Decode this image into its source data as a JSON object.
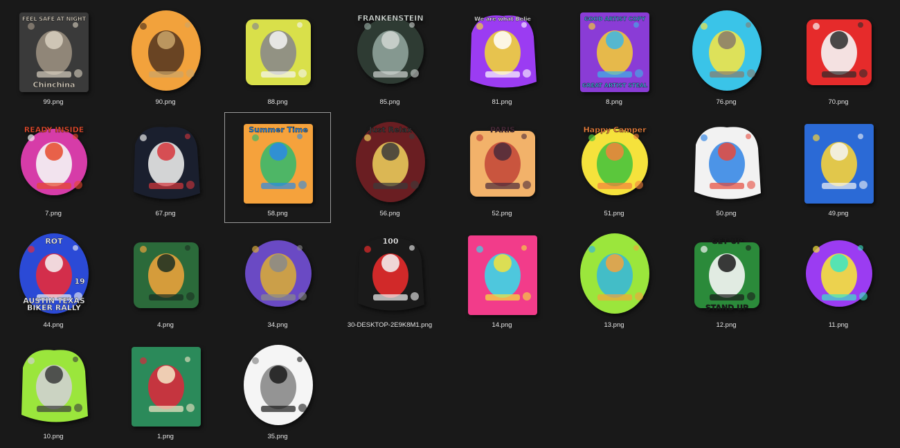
{
  "window": {
    "view": "Large icons"
  },
  "files": [
    {
      "name": "99.png",
      "icon": "night-animal-sticker-thumbnail",
      "palette": [
        "#3a3a3a",
        "#9a8f80",
        "#d9d0c0"
      ],
      "art_text": "FEEL SAFE AT NIGHT",
      "art_text2": "Chinchina"
    },
    {
      "name": "90.png",
      "icon": "hunter-with-dog-thumbnail",
      "palette": [
        "#f2a23c",
        "#5a3a20",
        "#caa56a"
      ]
    },
    {
      "name": "88.png",
      "icon": "money-gangster-badge-thumbnail",
      "palette": [
        "#d9e04a",
        "#8a8a8a",
        "#f5f5f5"
      ]
    },
    {
      "name": "85.png",
      "icon": "frankenstein-portrait-thumbnail",
      "palette": [
        "#2e3b33",
        "#8fa39a",
        "#d0d6d2"
      ],
      "art_text": "FRANKENSTEIN"
    },
    {
      "name": "81.png",
      "icon": "graffiti-lettering-thumbnail",
      "palette": [
        "#9b3cf2",
        "#f0d23c",
        "#ffffff"
      ],
      "art_text": "We are what Belie"
    },
    {
      "name": "8.png",
      "icon": "pop-art-artist-thumbnail",
      "palette": [
        "#8a3cd6",
        "#f0c63c",
        "#3cb6e6"
      ],
      "art_text": "GOOD ARTIST COPY",
      "art_text2": "GREAT ARTIST STEAL"
    },
    {
      "name": "76.png",
      "icon": "surfing-donkey-thumbnail",
      "palette": [
        "#3ac4e8",
        "#f0e44a",
        "#8a7a6a"
      ]
    },
    {
      "name": "70.png",
      "icon": "rooster-mascot-thumbnail",
      "palette": [
        "#e62b2b",
        "#f5f5f5",
        "#2b2b2b"
      ]
    },
    {
      "name": "7.png",
      "icon": "ready-inside-cartoon-thumbnail",
      "palette": [
        "#d63ca8",
        "#f5f5f5",
        "#e64a2b"
      ],
      "art_text": "READY INSIDE"
    },
    {
      "name": "67.png",
      "icon": "astronaut-guitarist-thumbnail",
      "palette": [
        "#1a1f2e",
        "#e8e8e8",
        "#d6363c"
      ]
    },
    {
      "name": "58.png",
      "icon": "summer-van-palms-thumbnail",
      "palette": [
        "#f5a23c",
        "#3cb86a",
        "#2b8ae6"
      ],
      "art_text": "Summer Time",
      "selected": true
    },
    {
      "name": "56.png",
      "icon": "just-relax-fishing-thumbnail",
      "palette": [
        "#6a1e22",
        "#e8c85a",
        "#3a3a3a"
      ],
      "art_text": "Just Relax"
    },
    {
      "name": "52.png",
      "icon": "paris-eiffel-poster-thumbnail",
      "palette": [
        "#f2b26a",
        "#c44a3a",
        "#4a2a3a"
      ],
      "art_text": "PARIS"
    },
    {
      "name": "51.png",
      "icon": "camper-sunset-thumbnail",
      "palette": [
        "#f5e23c",
        "#4ac43c",
        "#f2823c"
      ],
      "art_text": "Happy Camper"
    },
    {
      "name": "50.png",
      "icon": "lighthouse-beach-thumbnail",
      "palette": [
        "#f2f2f2",
        "#3a8ae6",
        "#e64a3c"
      ]
    },
    {
      "name": "49.png",
      "icon": "surfer-wave-thumbnail",
      "palette": [
        "#2b6ad6",
        "#f5d23c",
        "#f5f5f5"
      ]
    },
    {
      "name": "44.png",
      "icon": "biker-rally-texas-thumbnail",
      "palette": [
        "#2b4ad6",
        "#e62b3c",
        "#f5f5f5"
      ],
      "art_text": "ROT",
      "art_text2": "BIKER RALLY",
      "art_text3": "AUSTIN TEXAS",
      "art_text4": "19"
    },
    {
      "name": "4.png",
      "icon": "aquaman-trident-thumbnail",
      "palette": [
        "#2b6a3a",
        "#e8a23c",
        "#1a2e22"
      ]
    },
    {
      "name": "34.png",
      "icon": "pig-king-throne-thumbnail",
      "palette": [
        "#6a4ac4",
        "#d6a83c",
        "#8a8a8a"
      ]
    },
    {
      "name": "30-DESKTOP-2E9K8M1.png",
      "icon": "jet-ski-emblem-thumbnail",
      "palette": [
        "#1a1a1a",
        "#e62b2b",
        "#f5f5f5"
      ],
      "art_text": "100"
    },
    {
      "name": "14.png",
      "icon": "colorful-dog-portrait-thumbnail",
      "palette": [
        "#f23c8a",
        "#3cd6e6",
        "#f5e23c"
      ]
    },
    {
      "name": "13.png",
      "icon": "tropical-gorilla-sign-thumbnail",
      "palette": [
        "#9be63c",
        "#3ab8d6",
        "#f5a23c"
      ]
    },
    {
      "name": "12.png",
      "icon": "get-up-stand-up-gorilla-thumbnail",
      "palette": [
        "#2b8a3a",
        "#f5f5f5",
        "#1a1a1a"
      ],
      "art_text": "GET UP",
      "art_text2": "STAND UP"
    },
    {
      "name": "11.png",
      "icon": "purple-graffiti-tag-thumbnail",
      "palette": [
        "#9b3cf2",
        "#f5e23c",
        "#3ce6c4"
      ]
    },
    {
      "name": "10.png",
      "icon": "mechanic-skull-thumbnail",
      "palette": [
        "#9be63c",
        "#d0d0d0",
        "#3a3a3a"
      ]
    },
    {
      "name": "1.png",
      "icon": "dragon-roses-thumbnail",
      "palette": [
        "#2b8a5a",
        "#d62b3c",
        "#f5e8c8"
      ]
    },
    {
      "name": "35.png",
      "icon": "moon-woman-silhouette-thumbnail",
      "palette": [
        "#f5f5f5",
        "#8a8a8a",
        "#1a1a1a"
      ]
    }
  ]
}
